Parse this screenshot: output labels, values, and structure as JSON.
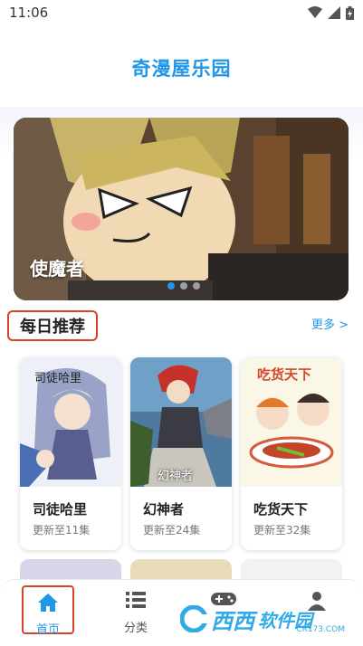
{
  "status_bar": {
    "time": "11:06"
  },
  "header": {
    "title": "奇漫屋乐园"
  },
  "banner": {
    "title": "使魔者",
    "dots": 3,
    "active_dot": 0
  },
  "section": {
    "title": "每日推荐",
    "more": "更多 >"
  },
  "cards": [
    {
      "name": "司徒哈里",
      "update": "更新至11集",
      "cover_text": "司徒哈里"
    },
    {
      "name": "幻神者",
      "update": "更新至24集",
      "cover_text": "幻神者"
    },
    {
      "name": "吃货天下",
      "update": "更新至32集",
      "cover_text": "吃货天下"
    }
  ],
  "tabs": [
    {
      "label": "首页",
      "icon": "home-icon",
      "active": true
    },
    {
      "label": "分类",
      "icon": "list-icon",
      "active": false
    },
    {
      "label": "",
      "icon": "gamepad-icon",
      "active": false
    },
    {
      "label": "",
      "icon": "user-icon",
      "active": false
    }
  ],
  "watermark": {
    "main": "西西",
    "sub": "软件园",
    "url": "CR173.COM"
  },
  "colors": {
    "accent": "#2196e8",
    "highlight_border": "#d9412c"
  }
}
